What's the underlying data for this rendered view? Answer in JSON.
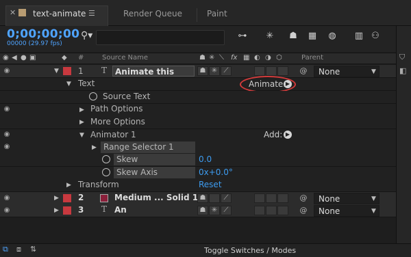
{
  "tabs": {
    "active": "text-animate",
    "render_queue": "Render Queue",
    "paint": "Paint"
  },
  "header": {
    "timecode": "0;00;00;00",
    "fps": "00000 (29.97 fps)",
    "search_glyph": "⚲▾"
  },
  "columns": {
    "hash": "#",
    "source_name": "Source Name",
    "fx": "fx",
    "parent": "Parent"
  },
  "layers": [
    {
      "num": "1",
      "name": "Animate this text",
      "parent": "None",
      "label_color": "#c8393f"
    },
    {
      "num": "2",
      "name": "Medium ... Solid 1",
      "parent": "None",
      "label_color": "#c8393f"
    },
    {
      "num": "3",
      "name": "An",
      "parent": "None",
      "label_color": "#c8393f"
    }
  ],
  "props": {
    "text": "Text",
    "animate": "Animate:",
    "source_text": "Source Text",
    "path_options": "Path Options",
    "more_options": "More Options",
    "animator": "Animator 1",
    "add": "Add:",
    "range_selector": "Range Selector 1",
    "skew": "Skew",
    "skew_value": "0.0",
    "skew_axis": "Skew Axis",
    "skew_axis_value": "0x+0.0°",
    "transform": "Transform",
    "reset": "Reset"
  },
  "footer": {
    "toggle": "Toggle Switches / Modes"
  },
  "colors": {
    "accent_blue": "#3d9cf0",
    "label_red": "#c8393f",
    "highlight_ring": "#d43b3b",
    "solid_swatch": "#8a1f3a"
  }
}
